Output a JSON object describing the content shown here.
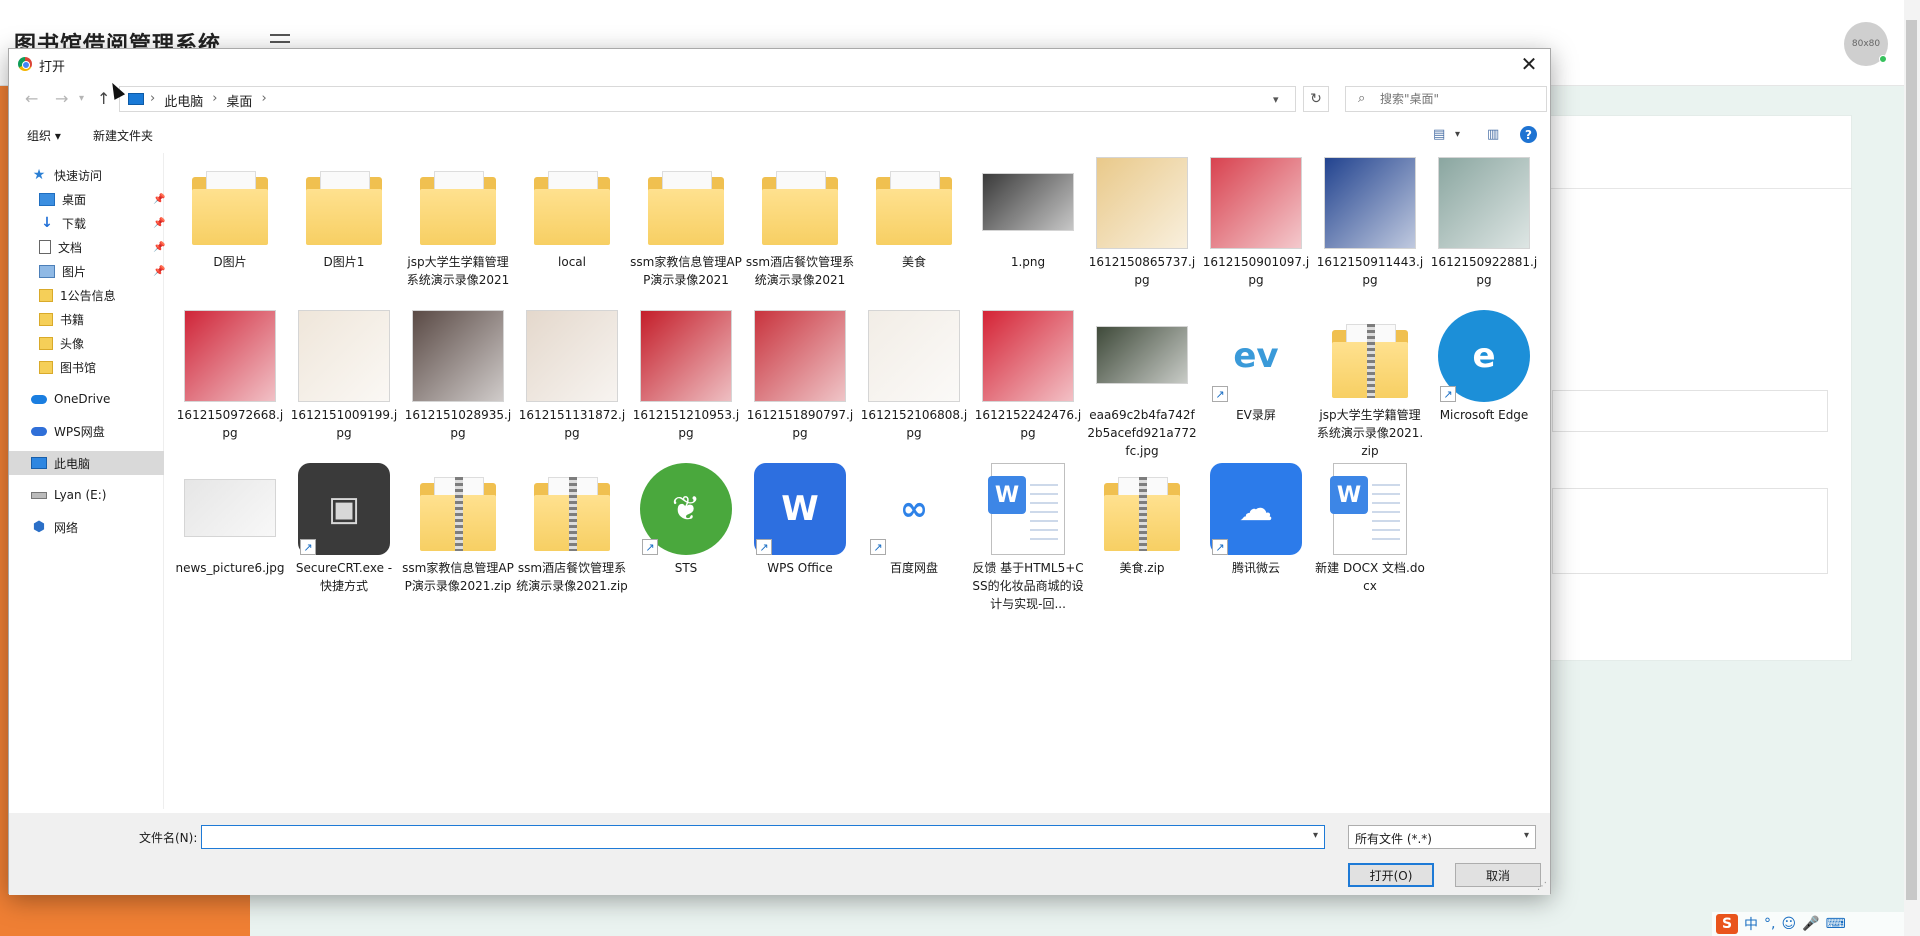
{
  "app": {
    "title": "图书馆借阅管理系统",
    "avatar_text": "80x80",
    "accent": "#ef7f34"
  },
  "dialog": {
    "title": "打开",
    "close_icon": "close-icon",
    "breadcrumbs": [
      "此电脑",
      "桌面"
    ],
    "search_placeholder": "搜索\"桌面\"",
    "toolbar": {
      "organize": "组织 ▾",
      "new_folder": "新建文件夹"
    },
    "sidebar": [
      {
        "label": "快速访问",
        "icon": "star-icon",
        "pinned": false
      },
      {
        "label": "桌面",
        "icon": "desktop-icon",
        "pinned": true
      },
      {
        "label": "下载",
        "icon": "download-icon",
        "pinned": true
      },
      {
        "label": "文档",
        "icon": "document-icon",
        "pinned": true
      },
      {
        "label": "图片",
        "icon": "pictures-icon",
        "pinned": true
      },
      {
        "label": "1公告信息",
        "icon": "folder-icon",
        "pinned": false
      },
      {
        "label": "书籍",
        "icon": "folder-icon",
        "pinned": false
      },
      {
        "label": "头像",
        "icon": "folder-icon",
        "pinned": false
      },
      {
        "label": "图书馆",
        "icon": "folder-icon",
        "pinned": false
      },
      {
        "label": "OneDrive",
        "icon": "onedrive-icon",
        "pinned": false
      },
      {
        "label": "WPS网盘",
        "icon": "wps-cloud-icon",
        "pinned": false
      },
      {
        "label": "此电脑",
        "icon": "computer-icon",
        "pinned": false,
        "selected": true
      },
      {
        "label": "Lyan (E:)",
        "icon": "drive-icon",
        "pinned": false
      },
      {
        "label": "网络",
        "icon": "network-icon",
        "pinned": false
      }
    ],
    "files": [
      {
        "name": "D图片",
        "kind": "folder"
      },
      {
        "name": "D图片1",
        "kind": "folder"
      },
      {
        "name": "jsp大学生学籍管理系统演示录像2021",
        "kind": "folder"
      },
      {
        "name": "local",
        "kind": "folder"
      },
      {
        "name": "ssm家教信息管理APP演示录像2021",
        "kind": "folder"
      },
      {
        "name": "ssm酒店餐饮管理系统演示录像2021",
        "kind": "folder"
      },
      {
        "name": "美食",
        "kind": "folder"
      },
      {
        "name": "1.png",
        "kind": "photo-wide",
        "color": "#3a3a3a"
      },
      {
        "name": "1612150865737.jpg",
        "kind": "photo",
        "color": "#e9c98a"
      },
      {
        "name": "1612150901097.jpg",
        "kind": "photo",
        "color": "#d8424f"
      },
      {
        "name": "1612150911443.jpg",
        "kind": "photo",
        "color": "#22438f"
      },
      {
        "name": "1612150922881.jpg",
        "kind": "photo",
        "color": "#8aa6a0"
      },
      {
        "name": "1612150972668.jpg",
        "kind": "photo",
        "color": "#cf2538"
      },
      {
        "name": "1612151009199.jpg",
        "kind": "photo",
        "color": "#efe6da"
      },
      {
        "name": "1612151028935.jpg",
        "kind": "photo",
        "color": "#5a4a45"
      },
      {
        "name": "1612151131872.jpg",
        "kind": "photo",
        "color": "#e4d8cc"
      },
      {
        "name": "1612151210953.jpg",
        "kind": "photo",
        "color": "#c41e2a"
      },
      {
        "name": "1612151890797.jpg",
        "kind": "photo",
        "color": "#c8333d"
      },
      {
        "name": "1612152106808.jpg",
        "kind": "photo",
        "color": "#f2ede6"
      },
      {
        "name": "1612152242476.jpg",
        "kind": "photo",
        "color": "#d42335"
      },
      {
        "name": "eaa69c2b4fa742f2b5acefd921a772fc.jpg",
        "kind": "photo-wide",
        "color": "#3f4a3a"
      },
      {
        "name": "EV录屏",
        "kind": "app",
        "color": "#ffffff",
        "glyph": "ev",
        "fg": "#3a9ad9",
        "shortcut": true
      },
      {
        "name": "jsp大学生学籍管理系统演示录像2021.zip",
        "kind": "zip"
      },
      {
        "name": "Microsoft Edge",
        "kind": "app",
        "color": "#1c8fd8",
        "glyph": "e",
        "fg": "#ffffff",
        "shortcut": true,
        "round": true
      },
      {
        "name": "news_picture6.jpg",
        "kind": "photo-wide",
        "color": "#e6e6e6"
      },
      {
        "name": "SecureCRT.exe - 快捷方式",
        "kind": "app",
        "color": "#3a3a3a",
        "glyph": "▣",
        "fg": "#d8d8d8",
        "shortcut": true
      },
      {
        "name": "ssm家教信息管理APP演示录像2021.zip",
        "kind": "zip"
      },
      {
        "name": "ssm酒店餐饮管理系统演示录像2021.zip",
        "kind": "zip"
      },
      {
        "name": "STS",
        "kind": "app",
        "color": "#4aa83d",
        "glyph": "❦",
        "fg": "#ffffff",
        "shortcut": true,
        "round": true
      },
      {
        "name": "WPS Office",
        "kind": "app",
        "color": "#2d6fe0",
        "glyph": "W",
        "fg": "#ffffff",
        "shortcut": true
      },
      {
        "name": "百度网盘",
        "kind": "app",
        "color": "#ffffff",
        "glyph": "∞",
        "fg": "#2e82e8",
        "shortcut": true
      },
      {
        "name": "反馈 基于HTML5+CSS的化妆品商城的设计与实现-回...",
        "kind": "docx"
      },
      {
        "name": "美食.zip",
        "kind": "zip"
      },
      {
        "name": "腾讯微云",
        "kind": "app",
        "color": "#2c7bea",
        "glyph": "☁",
        "fg": "#ffffff",
        "shortcut": true
      },
      {
        "name": "新建 DOCX 文档.docx",
        "kind": "docx"
      }
    ],
    "filename_label": "文件名(N):",
    "filename_value": "",
    "filter_value": "所有文件 (*.*)",
    "open_button": "打开(O)",
    "cancel_button": "取消"
  },
  "tray": {
    "items": [
      "S",
      "中",
      "°,",
      "☺",
      "🎤",
      "⌨"
    ]
  }
}
